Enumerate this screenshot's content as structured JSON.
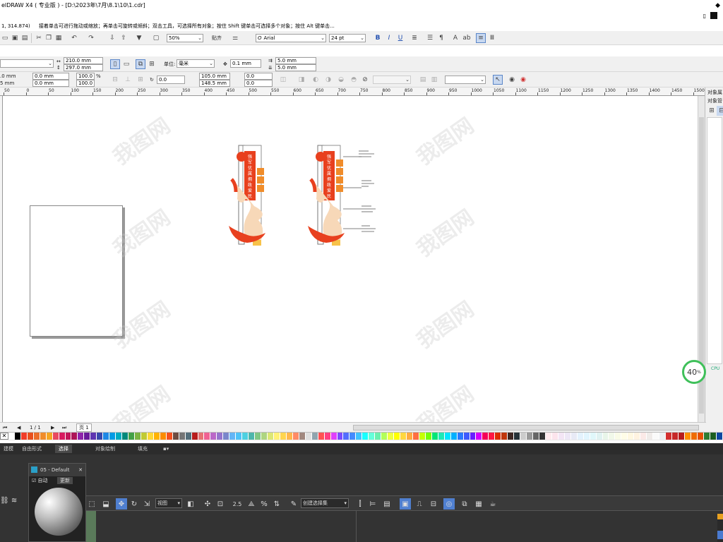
{
  "window": {
    "title": "elDRAW X4 ( 专业版 ) - [D:\\2023年\\7月\\8.1\\10\\1.cdr]",
    "coords": "1, 314.874)",
    "hint": "接着单击可进行拖动或缩放；再单击可旋转或倾斜；双击工具，可选择所有对象；按住 Shift 键单击可选择多个对象；按住 Alt 键单击..."
  },
  "toolbar1": {
    "zoom_value": "50%",
    "snap_label": "贴齐",
    "font_name": "Arial",
    "font_size": "24 pt"
  },
  "toolbar2": {
    "width": "210.0 mm",
    "height": "297.0 mm",
    "unit_label": "单位:",
    "unit_value": "毫米",
    "nudge": "0.1 mm",
    "dup_x": "5.0 mm",
    "dup_y": "5.0 mm"
  },
  "toolbar3": {
    "x1": ".0 mm",
    "y1": "5 mm",
    "w1": "0.0 mm",
    "h1": "0.0 mm",
    "sx": "100.0",
    "sy": "100.0",
    "pct": "%",
    "angle": "0.0",
    "px": "105.0 mm",
    "py": "148.5 mm",
    "r1": "0.0",
    "r2": "0.0"
  },
  "ruler": {
    "ticks": [
      "50",
      "0",
      "50",
      "100",
      "150",
      "200",
      "250",
      "300",
      "350",
      "400",
      "450",
      "500",
      "550",
      "600",
      "650",
      "700",
      "750",
      "800",
      "850",
      "900",
      "950",
      "1000",
      "1050",
      "1100",
      "1150",
      "1200",
      "1250",
      "1300",
      "1350",
      "1400",
      "1450",
      "1500"
    ]
  },
  "rightpanel": {
    "title1": "对象属",
    "title2": "对象管"
  },
  "status": {
    "page_counter": "1 / 1",
    "page_tab": "页 1"
  },
  "palette": [
    "#ffffff",
    "#000000",
    "#f03c28",
    "#e8501e",
    "#ea6e2c",
    "#f08c2a",
    "#f5a623",
    "#e84a5f",
    "#d81b60",
    "#c2185b",
    "#ad1457",
    "#8e24aa",
    "#6a1b9a",
    "#5e35b1",
    "#3949ab",
    "#1e88e5",
    "#039be5",
    "#00acc1",
    "#00897b",
    "#43a047",
    "#7cb342",
    "#c0ca33",
    "#fdd835",
    "#ffb300",
    "#fb8c00",
    "#f4511e",
    "#6d4c41",
    "#757575",
    "#546e7a",
    "#b71c1c",
    "#e57373",
    "#f06292",
    "#ba68c8",
    "#9575cd",
    "#7986cb",
    "#64b5f6",
    "#4fc3f7",
    "#4dd0e1",
    "#4db6ac",
    "#81c784",
    "#aed581",
    "#dce775",
    "#fff176",
    "#ffd54f",
    "#ffb74d",
    "#ff8a65",
    "#a1887f",
    "#e0e0e0",
    "#90a4ae",
    "#ff5252",
    "#ff4081",
    "#e040fb",
    "#7c4dff",
    "#536dfe",
    "#448aff",
    "#40c4ff",
    "#18ffff",
    "#64ffda",
    "#69f0ae",
    "#b2ff59",
    "#eeff41",
    "#ffff00",
    "#ffd740",
    "#ffab40",
    "#ff6e40",
    "#c6ff00",
    "#76ff03",
    "#00e676",
    "#1de9b6",
    "#00e5ff",
    "#00b0ff",
    "#2979ff",
    "#3d5afe",
    "#651fff",
    "#d500f9",
    "#f50057",
    "#ff1744",
    "#dd2c00",
    "#bf360c",
    "#3e2723",
    "#263238",
    "#cccccc",
    "#999999",
    "#666666",
    "#333333",
    "#ffebee",
    "#fce4ec",
    "#f3e5f5",
    "#ede7f6",
    "#e8eaf6",
    "#e3f2fd",
    "#e1f5fe",
    "#e0f7fa",
    "#e0f2f1",
    "#e8f5e9",
    "#f1f8e9",
    "#f9fbe7",
    "#fffde7",
    "#fff8e1",
    "#fff3e0",
    "#fbe9e7",
    "#efebe9",
    "#fafafa",
    "#eceff1",
    "#d32f2f",
    "#c62828",
    "#b71c1c",
    "#ff8f00",
    "#ef6c00",
    "#e65100",
    "#2e7d32",
    "#1b5e20",
    "#0d47a1"
  ],
  "max": {
    "tabs": [
      "建模",
      "自由形式",
      "选择",
      "对象绘制",
      "填充"
    ],
    "material_title": "05 - Default",
    "auto_label": "自动",
    "update_label": "更新",
    "view_dropdown": "视图",
    "selection_set": "创建选择集",
    "angle_snap": "2.5"
  },
  "cpu": {
    "value": "40",
    "unit": "%"
  },
  "watermark": "我图网",
  "signs": {
    "banner": [
      "强",
      "军",
      "优",
      "属",
      "拥",
      "政",
      "爱",
      "民"
    ]
  }
}
